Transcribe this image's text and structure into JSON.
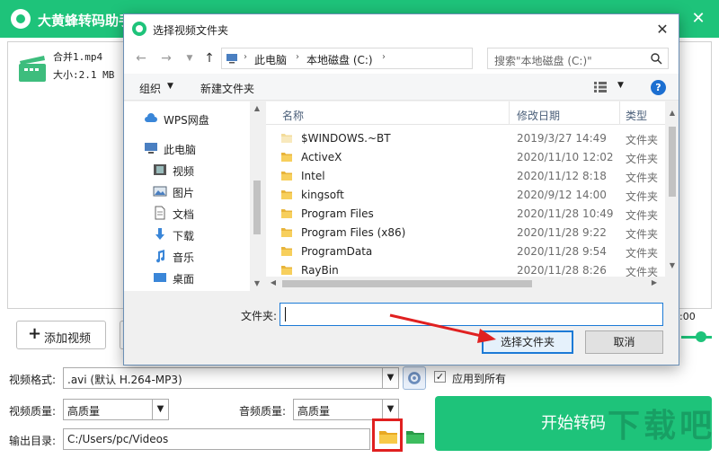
{
  "app": {
    "title": "大黄蜂转码助手",
    "header_hint_a": "· · · ·",
    "header_hint_b": "· · · · ·",
    "file": {
      "name": "合并1.mp4",
      "size": "大小:2.1 MB"
    },
    "preview_time": ":00",
    "add_video_label": "添加视频",
    "format_label": "视频格式:",
    "format_value": ".avi (默认 H.264-MP3)",
    "apply_all_label": "应用到所有",
    "video_quality_label": "视频质量:",
    "video_quality_value": "高质量",
    "audio_quality_label": "音频质量:",
    "audio_quality_value": "高质量",
    "output_label": "输出目录:",
    "output_value": "C:/Users/pc/Videos",
    "start_label": "开始转码",
    "watermark": "下载吧"
  },
  "dialog": {
    "title": "选择视频文件夹",
    "breadcrumb": [
      "此电脑",
      "本地磁盘 (C:)"
    ],
    "search_placeholder": "搜索\"本地磁盘 (C:)\"",
    "toolbar": {
      "organize": "组织",
      "new_folder": "新建文件夹",
      "help": "?"
    },
    "nav_items": [
      {
        "label": "WPS网盘",
        "icon": "cloud-icon"
      },
      {
        "label": "此电脑",
        "icon": "computer-icon"
      },
      {
        "label": "视频",
        "icon": "video-icon"
      },
      {
        "label": "图片",
        "icon": "pictures-icon"
      },
      {
        "label": "文档",
        "icon": "documents-icon"
      },
      {
        "label": "下载",
        "icon": "download-icon"
      },
      {
        "label": "音乐",
        "icon": "music-icon"
      },
      {
        "label": "桌面",
        "icon": "desktop-icon"
      }
    ],
    "columns": {
      "name": "名称",
      "date": "修改日期",
      "type": "类型"
    },
    "files": [
      {
        "name": "$WINDOWS.~BT",
        "date": "2019/3/27 14:49",
        "type": "文件夹"
      },
      {
        "name": "ActiveX",
        "date": "2020/11/10 12:02",
        "type": "文件夹"
      },
      {
        "name": "Intel",
        "date": "2020/11/12 8:18",
        "type": "文件夹"
      },
      {
        "name": "kingsoft",
        "date": "2020/9/12 14:00",
        "type": "文件夹"
      },
      {
        "name": "Program Files",
        "date": "2020/11/28 10:49",
        "type": "文件夹"
      },
      {
        "name": "Program Files (x86)",
        "date": "2020/11/28 9:22",
        "type": "文件夹"
      },
      {
        "name": "ProgramData",
        "date": "2020/11/28 9:54",
        "type": "文件夹"
      },
      {
        "name": "RayBin",
        "date": "2020/11/28 8:26",
        "type": "文件夹"
      }
    ],
    "folder_label": "文件夹:",
    "folder_value": "",
    "select_button": "选择文件夹",
    "cancel_button": "取消"
  },
  "colors": {
    "accent": "#1ec37a",
    "highlight": "#e02020",
    "dialog_blue": "#1c7ad6"
  }
}
